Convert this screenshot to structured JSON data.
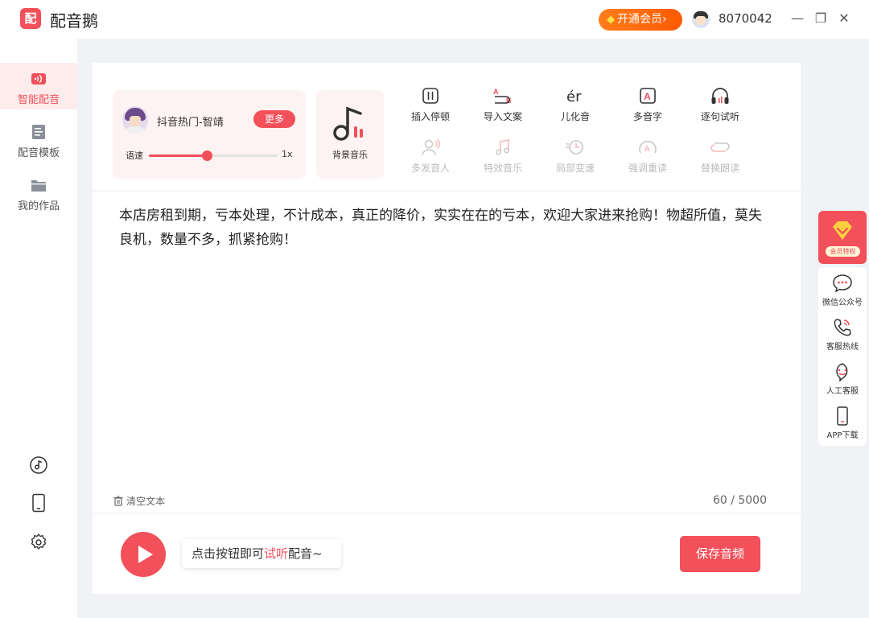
{
  "app": {
    "logo_char": "配",
    "name": "配音鹅"
  },
  "header": {
    "vip_label": "开通会员",
    "vip_arrow": "›",
    "user_id": "8070042",
    "minimize": "—",
    "restore": "❐",
    "close": "✕"
  },
  "sidebar": {
    "items": [
      {
        "label": "智能配音",
        "icon": "smart-dubbing-icon",
        "active": true
      },
      {
        "label": "配音模板",
        "icon": "template-icon",
        "active": false
      },
      {
        "label": "我的作品",
        "icon": "folder-icon",
        "active": false
      }
    ],
    "bottom_icons": [
      "music-disc-icon",
      "phone-icon",
      "gear-icon"
    ]
  },
  "voice": {
    "name": "抖音热门-智靖",
    "more_label": "更多",
    "speed_label": "语速",
    "speed_value": "1x",
    "speed_fraction": 0.45
  },
  "bgm": {
    "label": "背景音乐"
  },
  "tools": [
    {
      "label": "插入停顿",
      "icon": "pause-insert-icon",
      "enabled": true
    },
    {
      "label": "导入文案",
      "icon": "import-text-icon",
      "enabled": true
    },
    {
      "label": "儿化音",
      "icon": "erhua-icon",
      "enabled": true
    },
    {
      "label": "多音字",
      "icon": "polyphone-icon",
      "enabled": true
    },
    {
      "label": "逐句试听",
      "icon": "headphones-icon",
      "enabled": true
    },
    {
      "label": "多发音人",
      "icon": "multi-speaker-icon",
      "enabled": false
    },
    {
      "label": "特效音乐",
      "icon": "effect-music-icon",
      "enabled": false
    },
    {
      "label": "局部变速",
      "icon": "partial-speed-icon",
      "enabled": false
    },
    {
      "label": "强调重读",
      "icon": "emphasis-icon",
      "enabled": false
    },
    {
      "label": "替换朗读",
      "icon": "replace-read-icon",
      "enabled": false
    }
  ],
  "tool_glyphs": {
    "erhua": "ér",
    "polyphone": "A",
    "import_a": "A",
    "import_b": "B"
  },
  "editor": {
    "text": "本店房租到期，亏本处理，不计成本，真正的降价，实实在在的亏本，欢迎大家进来抢购！物超所值，莫失良机，数量不多，抓紧抢购！",
    "clear_label": "清空文本",
    "char_count": "60 / 5000"
  },
  "player": {
    "hint_prefix": "点击按钮即可",
    "hint_highlight": "试听",
    "hint_suffix": "配音~",
    "save_label": "保存音频"
  },
  "float_panel": {
    "vip_tag": "会员特权",
    "items": [
      {
        "label": "微信公众号",
        "icon": "wechat-chat-icon"
      },
      {
        "label": "客服热线",
        "icon": "phone-call-icon"
      },
      {
        "label": "人工客服",
        "icon": "service-face-icon"
      },
      {
        "label": "APP下载",
        "icon": "mobile-icon"
      }
    ]
  },
  "colors": {
    "accent": "#f2505a",
    "vip_orange": "#ff6a00",
    "background": "#f1f2f6"
  }
}
